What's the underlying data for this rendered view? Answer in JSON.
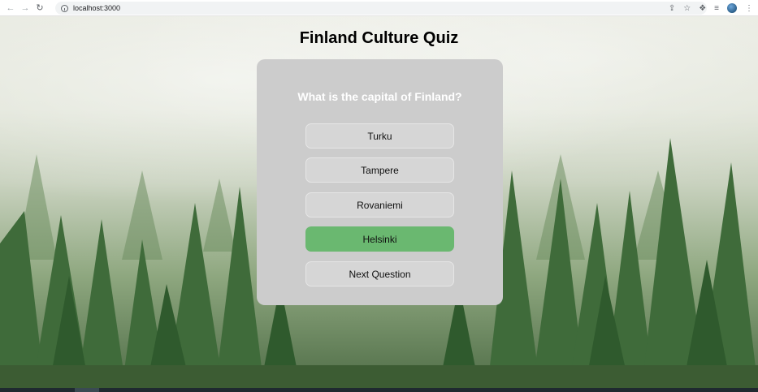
{
  "browser": {
    "url": "localhost:3000"
  },
  "page": {
    "title": "Finland Culture Quiz"
  },
  "quiz": {
    "question": "What is the capital of Finland?",
    "answers": [
      {
        "label": "Turku",
        "state": "default"
      },
      {
        "label": "Tampere",
        "state": "default"
      },
      {
        "label": "Rovaniemi",
        "state": "default"
      },
      {
        "label": "Helsinki",
        "state": "correct"
      }
    ],
    "next_label": "Next Question"
  },
  "colors": {
    "card_bg": "#cccccc",
    "correct": "#6ab870",
    "question_text": "#ffffff"
  },
  "icons": {
    "back": "arrow-left-icon",
    "forward": "arrow-right-icon",
    "reload": "reload-icon",
    "site_info": "info-icon",
    "share": "share-icon",
    "bookmark": "star-icon",
    "extensions": "puzzle-icon",
    "media": "media-queue-icon",
    "menu": "kebab-menu-icon"
  }
}
